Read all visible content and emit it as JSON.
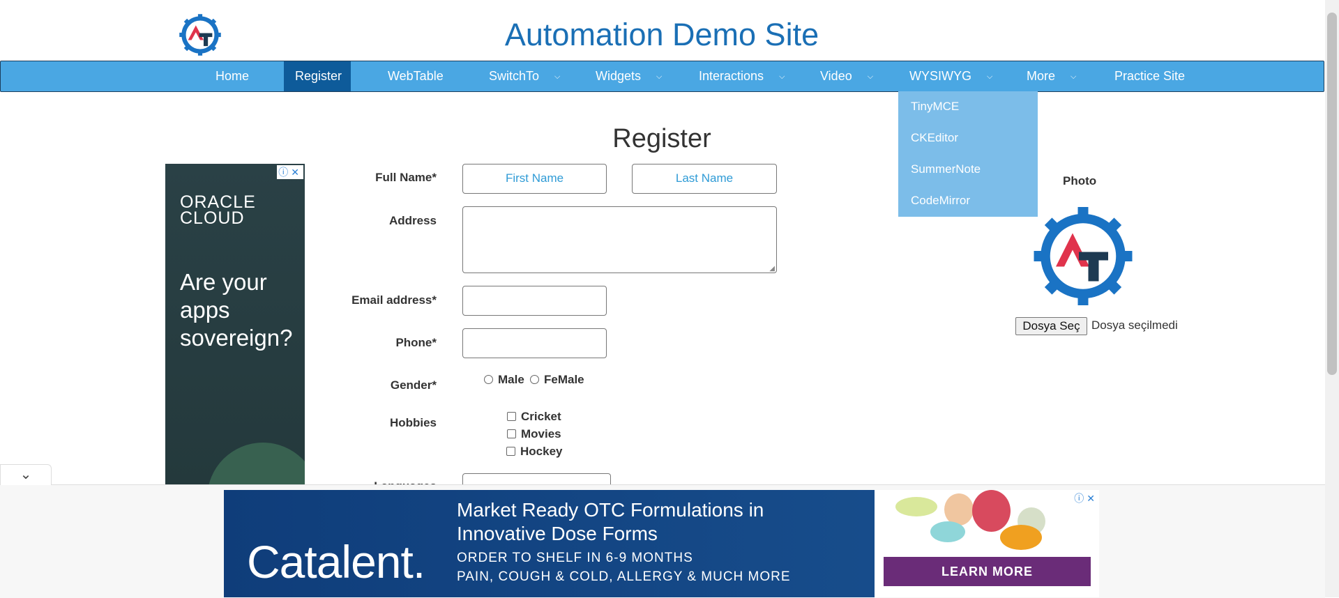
{
  "header": {
    "title": "Automation Demo Site"
  },
  "nav": {
    "items": [
      {
        "label": "Home"
      },
      {
        "label": "Register"
      },
      {
        "label": "WebTable"
      },
      {
        "label": "SwitchTo"
      },
      {
        "label": "Widgets"
      },
      {
        "label": "Interactions"
      },
      {
        "label": "Video"
      },
      {
        "label": "WYSIWYG"
      },
      {
        "label": "More"
      },
      {
        "label": "Practice Site"
      }
    ],
    "active": "Register",
    "dropdown": [
      "TinyMCE",
      "CKEditor",
      "SummerNote",
      "CodeMirror"
    ]
  },
  "page": {
    "title": "Register"
  },
  "form": {
    "full_name_label": "Full Name*",
    "first_name_placeholder": "First Name",
    "last_name_placeholder": "Last Name",
    "address_label": "Address",
    "email_label": "Email address*",
    "phone_label": "Phone*",
    "gender_label": "Gender*",
    "gender_options": [
      "Male",
      "FeMale"
    ],
    "hobbies_label": "Hobbies",
    "hobbies": [
      "Cricket",
      "Movies",
      "Hockey"
    ],
    "languages_label": "Languages"
  },
  "photo": {
    "label": "Photo",
    "button": "Dosya Seç",
    "status": "Dosya seçilmedi"
  },
  "ads": {
    "left": {
      "brand_line1": "ORACLE",
      "brand_line2": "CLOUD",
      "copy": "Are your apps sovereign?"
    },
    "bottom": {
      "brand": "Catalent.",
      "headline_line1": "Market Ready OTC Formulations in",
      "headline_line2": "Innovative Dose Forms",
      "sub_line1": "ORDER TO SHELF IN 6-9 MONTHS",
      "sub_line2": "PAIN, COUGH & COLD, ALLERGY & MUCH MORE",
      "cta": "LEARN MORE"
    }
  },
  "colors": {
    "nav_bg": "#4aa7e3",
    "nav_active": "#0e5b9a",
    "dropdown_bg": "#7cbde9",
    "title_blue": "#1a6fb5",
    "logo_blue": "#1a73c4",
    "logo_red": "#e0334c",
    "logo_dark": "#1d3a52"
  }
}
